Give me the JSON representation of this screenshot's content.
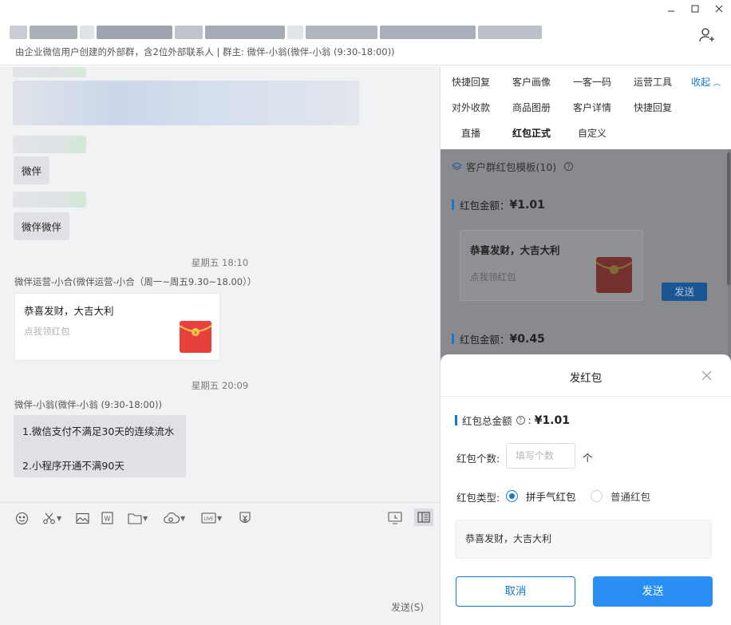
{
  "header": {
    "subtitle": "由企业微信用户创建的外部群，含2位外部联系人 | 群主: 微伴-小翁(微伴-小翁 (9:30-18:00))"
  },
  "chat": {
    "messages_plain": [
      "微伴",
      "微伴微伴"
    ],
    "time_1": "星期五 18:10",
    "sender_1": "微伴运营-小合(微伴运营-小合（周一~周五9.30~18.00））",
    "card_title": "恭喜发财，大吉大利",
    "card_sub": "点我领红包",
    "time_2": "星期五 20:09",
    "sender_2": "微伴-小翁(微伴-小翁 (9:30-18:00))",
    "msg_line1": "1.微信支付不满足30天的连续流水",
    "msg_line2": "2.小程序开通不满90天"
  },
  "input": {
    "send_label": "发送(S)"
  },
  "panel": {
    "tabs_row1": [
      "快捷回复",
      "客户画像",
      "一客一码",
      "运营工具"
    ],
    "collapse_label": "收起",
    "tabs_row2": [
      "对外收款",
      "商品图册",
      "客户详情",
      "快捷回复"
    ],
    "tabs_row3": [
      "直播",
      "红包正式",
      "自定义"
    ],
    "template_title": "客户群红包模板(10)",
    "amount_1_label": "红包金额：",
    "amount_1_value": "¥1.01",
    "tpl_card_title": "恭喜发财，大吉大利",
    "tpl_card_sub": "点我领红包",
    "tpl_send": "发送",
    "amount_2_label": "红包金额：",
    "amount_2_value": "¥0.45"
  },
  "modal": {
    "title": "发红包",
    "total_label": "红包总金额",
    "total_value": "¥1.01",
    "count_label": "红包个数:",
    "count_placeholder": "填写个数",
    "count_unit": "个",
    "type_label": "红包类型:",
    "type_options": [
      "拼手气红包",
      "普通红包"
    ],
    "type_selected": "拼手气红包",
    "wish_text": "恭喜发财，大吉大利",
    "cancel_label": "取消",
    "send_label": "发送"
  },
  "colors": {
    "accent": "#1677d2",
    "send_button": "#2a8ff5",
    "envelope_red": "#e8413d",
    "envelope_gold": "#f3c64a"
  }
}
